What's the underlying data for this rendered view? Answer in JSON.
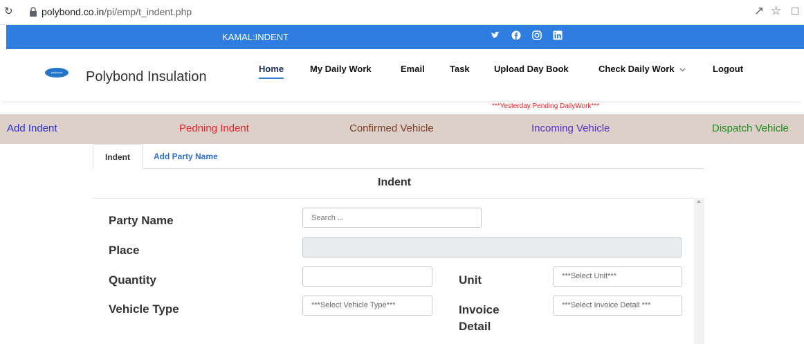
{
  "browser": {
    "url_host": "polybond.co.in",
    "url_path": "/pi/emp/t_indent.php"
  },
  "topbar": {
    "title": "KAMAL:INDENT",
    "social_icons": [
      "twitter-icon",
      "facebook-icon",
      "instagram-icon",
      "linkedin-icon"
    ]
  },
  "header": {
    "logo_text": "polybond",
    "brand": "Polybond Insulation",
    "nav": {
      "home": "Home",
      "daily_work": "My Daily Work",
      "email": "Email",
      "task": "Task",
      "upload": "Upload Day Book",
      "check": "Check Daily Work",
      "logout": "Logout"
    }
  },
  "notice": "***Yesterday Pending DailyWork***",
  "strip": {
    "add_indent": "Add Indent",
    "pending_indent": "Pedning Indent",
    "confirmed_vehicle": "Confirmed Vehicle",
    "incoming_vehicle": "Incoming Vehicle",
    "dispatch_vehicle": "Dispatch Vehicle"
  },
  "tabs": {
    "indent": "Indent",
    "add_party": "Add Party Name"
  },
  "section_title": "Indent",
  "form": {
    "party_name_label": "Party Name",
    "party_name_placeholder": "Search ...",
    "place_label": "Place",
    "quantity_label": "Quantity",
    "unit_label": "Unit",
    "unit_select": "***Select Unit***",
    "vehicle_type_label": "Vehicle Type",
    "vehicle_type_select": "***Select Vehicle Type***",
    "invoice_label_1": "Invoice",
    "invoice_label_2": "Detail",
    "invoice_select": "***Select Invoice Detail ***"
  },
  "colors": {
    "topbar": "#2e7de0",
    "strip": "#ddd0c8",
    "add_indent": "#2b2bd6",
    "pending_indent": "#e8202a",
    "confirmed_vehicle": "#7a3a2a",
    "incoming_vehicle": "#5a2ec8",
    "dispatch_vehicle": "#1c8a1c"
  }
}
